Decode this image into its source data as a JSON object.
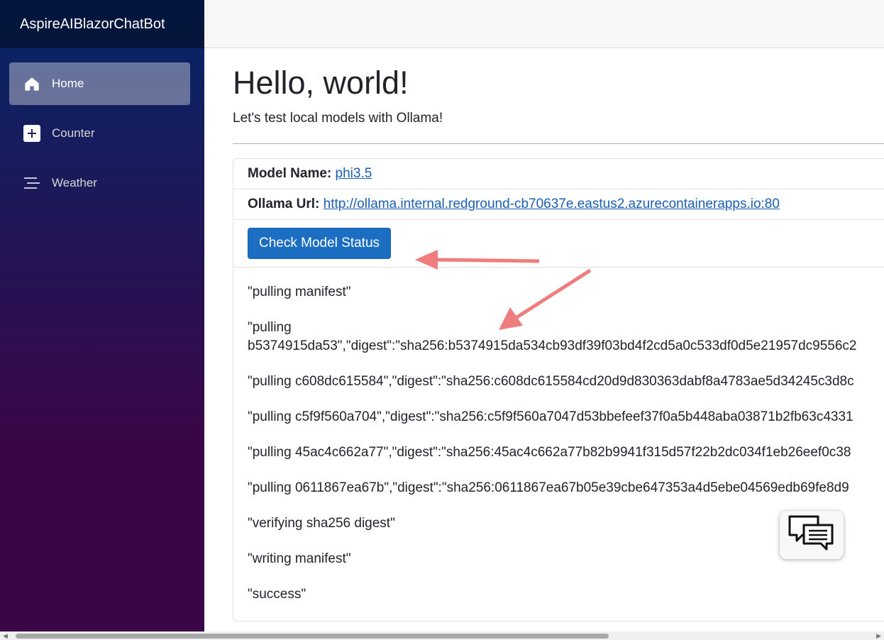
{
  "app": {
    "title": "AspireAIBlazorChatBot"
  },
  "sidebar": {
    "items": [
      {
        "label": "Home",
        "icon": "home-icon",
        "active": true
      },
      {
        "label": "Counter",
        "icon": "plus-icon",
        "active": false
      },
      {
        "label": "Weather",
        "icon": "list-icon",
        "active": false
      }
    ]
  },
  "page": {
    "heading": "Hello, world!",
    "lead": "Let's test local models with Ollama!"
  },
  "model": {
    "name_label": "Model Name:",
    "name_value": "phi3.5",
    "url_label": "Ollama Url:",
    "url_value": "http://ollama.internal.redground-cb70637e.eastus2.azurecontainerapps.io:80",
    "button_label": "Check Model Status"
  },
  "log": [
    "\"pulling manifest\"",
    "\"pulling b5374915da53\",\"digest\":\"sha256:b5374915da534cb93df39f03bd4f2cd5a0c533df0d5e21957dc9556c2",
    "\"pulling c608dc615584\",\"digest\":\"sha256:c608dc615584cd20d9d830363dabf8a4783ae5d34245c3d8c",
    "\"pulling c5f9f560a704\",\"digest\":\"sha256:c5f9f560a7047d53bbefeef37f0a5b448aba03871b2fb63c4331",
    "\"pulling 45ac4c662a77\",\"digest\":\"sha256:45ac4c662a77b82b9941f315d57f22b2dc034f1eb26eef0c38",
    "\"pulling 0611867ea67b\",\"digest\":\"sha256:0611867ea67b05e39cbe647353a4d5ebe04569edb69fe8d9",
    "\"verifying sha256 digest\"",
    "\"writing manifest\"",
    "\"success\""
  ],
  "colors": {
    "sidebar_top": "#052767",
    "sidebar_bottom": "#3a0647",
    "button": "#1b6ec2",
    "link": "#1a5fb4",
    "annotation_arrow": "#ef7d7d"
  }
}
